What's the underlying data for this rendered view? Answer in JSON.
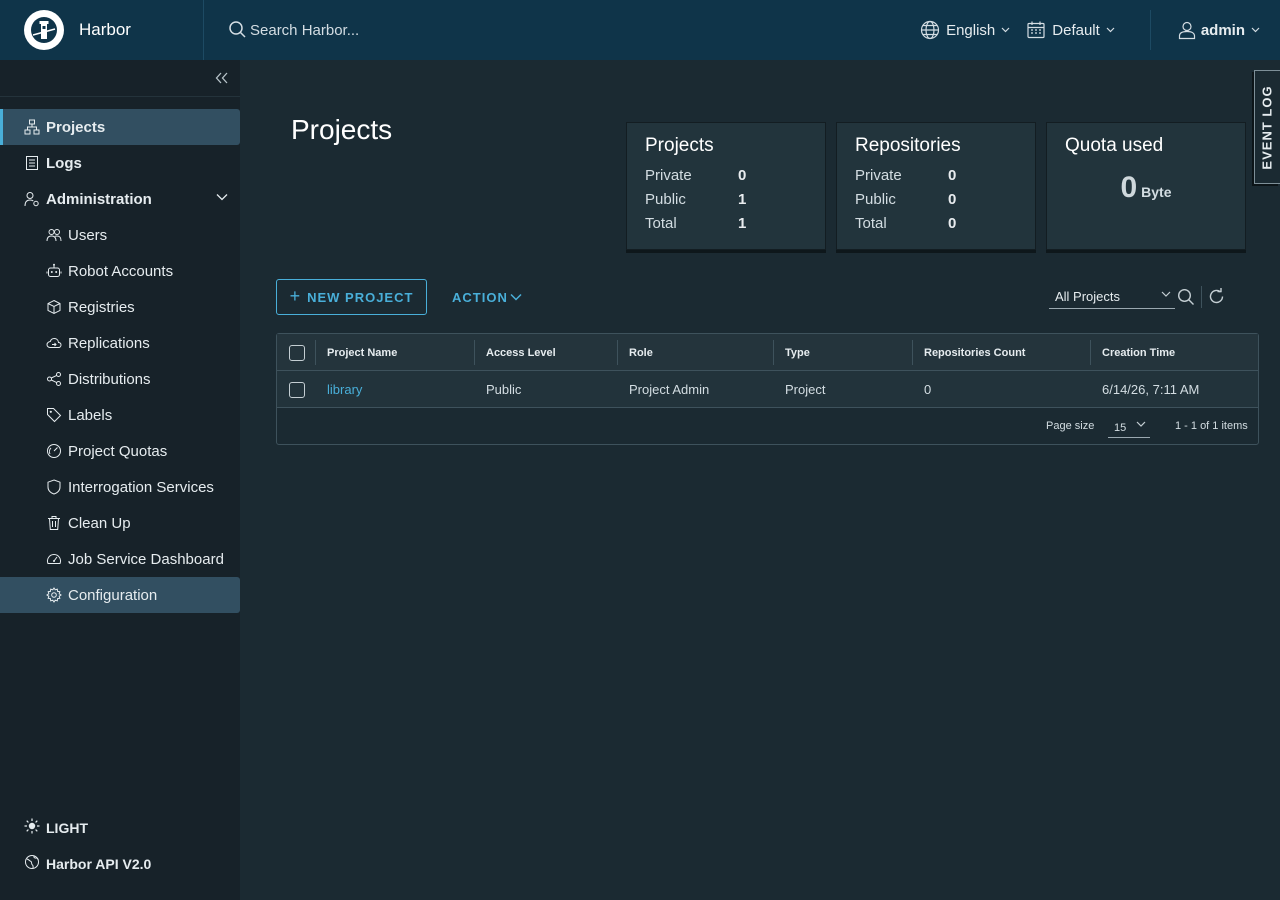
{
  "header": {
    "brand": "Harbor",
    "search_placeholder": "Search Harbor...",
    "language": "English",
    "theme": "Default",
    "user": "admin"
  },
  "sidebar": {
    "top_items": [
      {
        "label": "Projects",
        "icon": "projects-icon"
      },
      {
        "label": "Logs",
        "icon": "logs-icon"
      },
      {
        "label": "Administration",
        "icon": "administration-icon"
      }
    ],
    "admin_items": [
      {
        "label": "Users",
        "icon": "users-icon"
      },
      {
        "label": "Robot Accounts",
        "icon": "robot-icon"
      },
      {
        "label": "Registries",
        "icon": "registries-icon"
      },
      {
        "label": "Replications",
        "icon": "replications-icon"
      },
      {
        "label": "Distributions",
        "icon": "distributions-icon"
      },
      {
        "label": "Labels",
        "icon": "labels-icon"
      },
      {
        "label": "Project Quotas",
        "icon": "quota-icon"
      },
      {
        "label": "Interrogation Services",
        "icon": "shield-icon"
      },
      {
        "label": "Clean Up",
        "icon": "trash-icon"
      },
      {
        "label": "Job Service Dashboard",
        "icon": "dashboard-icon"
      },
      {
        "label": "Configuration",
        "icon": "gear-icon"
      }
    ],
    "bottom": {
      "theme_toggle": "LIGHT",
      "api_link": "Harbor API V2.0"
    }
  },
  "main": {
    "title": "Projects",
    "cards": {
      "projects": {
        "title": "Projects",
        "rows": [
          {
            "label": "Private",
            "value": "0"
          },
          {
            "label": "Public",
            "value": "1"
          },
          {
            "label": "Total",
            "value": "1"
          }
        ]
      },
      "repositories": {
        "title": "Repositories",
        "rows": [
          {
            "label": "Private",
            "value": "0"
          },
          {
            "label": "Public",
            "value": "0"
          },
          {
            "label": "Total",
            "value": "0"
          }
        ]
      },
      "quota": {
        "title": "Quota used",
        "value": "0",
        "unit": "Byte"
      }
    },
    "new_project_label": "NEW PROJECT",
    "action_label": "ACTION",
    "filter_value": "All Projects",
    "table": {
      "columns": [
        "Project Name",
        "Access Level",
        "Role",
        "Type",
        "Repositories Count",
        "Creation Time"
      ],
      "rows": [
        {
          "name": "library",
          "access": "Public",
          "role": "Project Admin",
          "type": "Project",
          "repo_count": "0",
          "created": "6/14/26, 7:11 AM"
        }
      ],
      "page_size_label": "Page size",
      "page_size": "15",
      "count_text": "1 - 1 of 1 items"
    },
    "event_log_label": "EVENT LOG"
  },
  "colors": {
    "accent": "#49afd9",
    "header_bg": "#0f3449",
    "sidebar_bg": "#172229",
    "content_bg": "#1b2a32",
    "active_item_bg": "#324f61"
  }
}
